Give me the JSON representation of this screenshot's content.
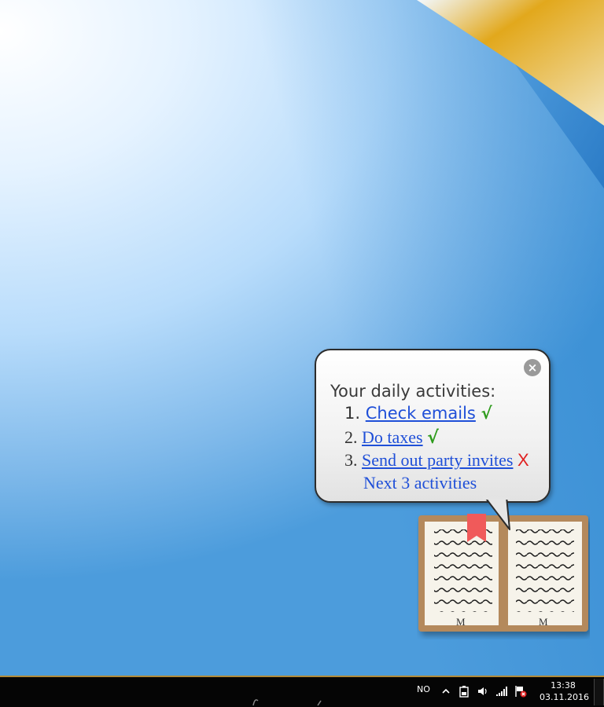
{
  "popup": {
    "close_glyph": "×",
    "title": "Your daily activities:",
    "items": [
      {
        "number": "1.",
        "label": "Check emails",
        "status": "√",
        "status_kind": "done"
      },
      {
        "number": "2.",
        "label": "Do taxes",
        "status": "√",
        "status_kind": "done"
      },
      {
        "number": "3.",
        "label": "Send out party invites",
        "status": "X",
        "status_kind": "not-done"
      }
    ],
    "next_link": "Next 3 activities"
  },
  "book": {
    "left_page_letter": "M",
    "right_page_letter": "M",
    "icon": "open-book-icon"
  },
  "taskbar": {
    "language": "NO",
    "time": "13:38",
    "date": "03.11.2016",
    "icons": [
      "chevron-up-icon",
      "battery-icon",
      "volume-icon",
      "signal-icon",
      "action-center-flag-icon"
    ]
  },
  "colors": {
    "link": "#1f4fd8",
    "check": "#2e9b1c",
    "cross": "#e02020",
    "bookmark": "#f05a5a",
    "book_cover": "#b4895c"
  }
}
